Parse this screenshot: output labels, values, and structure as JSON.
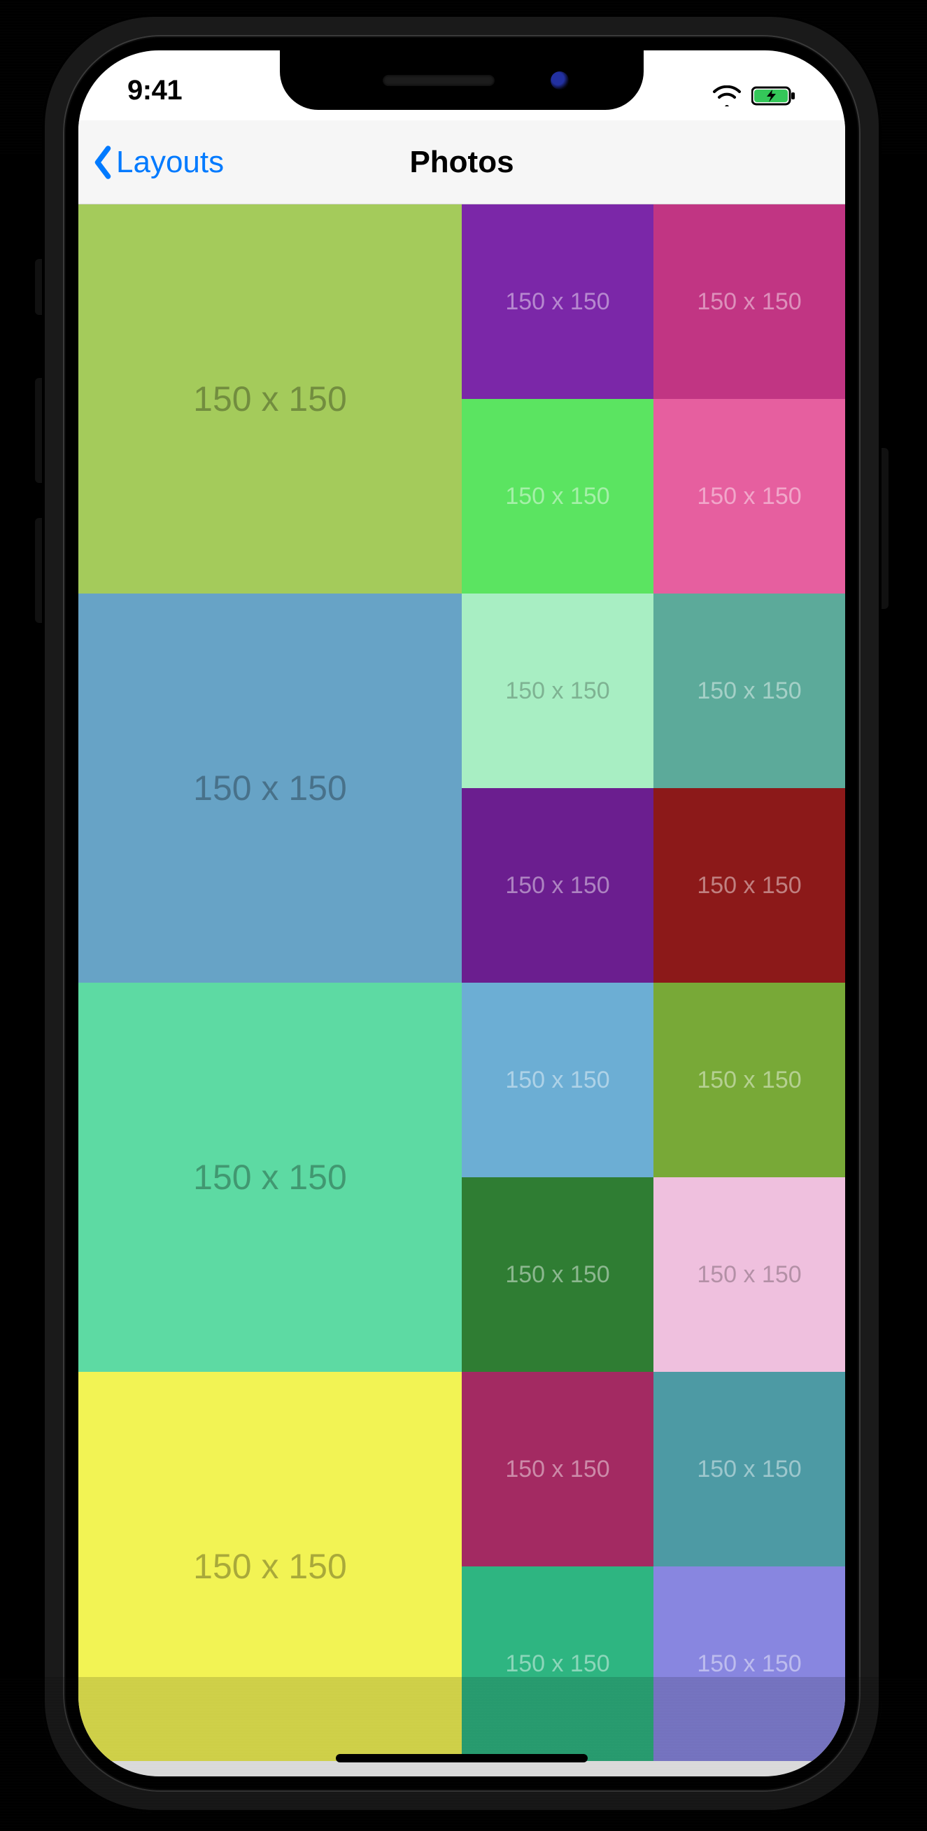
{
  "statusbar": {
    "time": "9:41"
  },
  "navbar": {
    "back_label": "Layouts",
    "title": "Photos"
  },
  "grid": {
    "cell_label": "150 x 150",
    "cells": [
      {
        "big": true,
        "bg": "#A4CB5B",
        "light": false
      },
      {
        "big": false,
        "bg": "#7B27A8",
        "light": true
      },
      {
        "big": false,
        "bg": "#C13583",
        "light": true
      },
      {
        "big": false,
        "bg": "#5BE461",
        "light": true
      },
      {
        "big": false,
        "bg": "#E65F9F",
        "light": true
      },
      {
        "big": true,
        "bg": "#67A3C6",
        "light": false
      },
      {
        "big": false,
        "bg": "#A8EEC3",
        "light": false
      },
      {
        "big": false,
        "bg": "#5CAA9A",
        "light": true
      },
      {
        "big": false,
        "bg": "#6B1E8F",
        "light": true
      },
      {
        "big": false,
        "bg": "#8C1919",
        "light": true
      },
      {
        "big": true,
        "bg": "#5DDAA3",
        "light": false
      },
      {
        "big": false,
        "bg": "#6CAED4",
        "light": true
      },
      {
        "big": false,
        "bg": "#78A937",
        "light": true
      },
      {
        "big": false,
        "bg": "#2F7D33",
        "light": true
      },
      {
        "big": false,
        "bg": "#EFC0DE",
        "light": false
      },
      {
        "big": true,
        "bg": "#F2F354",
        "light": false
      },
      {
        "big": false,
        "bg": "#A32A62",
        "light": true
      },
      {
        "big": false,
        "bg": "#4D9AA4",
        "light": true
      },
      {
        "big": false,
        "bg": "#2EB581",
        "light": true
      },
      {
        "big": false,
        "bg": "#8886E0",
        "light": true
      }
    ]
  }
}
